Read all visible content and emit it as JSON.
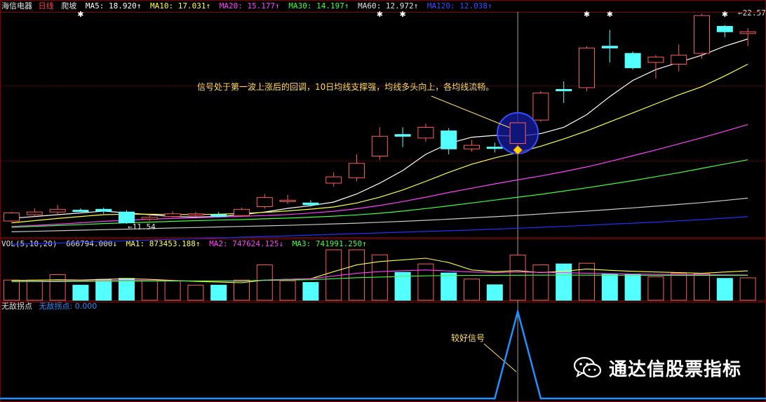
{
  "header_main": {
    "stock_name": "海信电器",
    "period": "日线",
    "indicator": "爬坡",
    "ma5": "MA5: 18.920↑",
    "ma10": "MA10: 17.031↑",
    "ma20": "MA20: 15.177↑",
    "ma30": "MA30: 14.197↑",
    "ma60": "MA60: 12.972↑",
    "ma120": "MA120: 12.038↑"
  },
  "header_vol": {
    "label": "VOL(5,10,20)",
    "vol": "666794.000↓",
    "ma1": "MA1: 873453.188↑",
    "ma2": "MA2: 747624.125↓",
    "ma3": "MA3: 741991.250↑"
  },
  "header_sig": {
    "label": "无敌拐点",
    "value": "无敌拐点: 0.000"
  },
  "annotations": {
    "main_note": "信号处于第一波上涨后的回调，10日均线支撑强，均线多头向上，各均线流畅。",
    "signal_note": "较好信号",
    "high_label": "22.57",
    "low_label": "11.54"
  },
  "watermark": {
    "text": "通达信股票指标",
    "icon": "wechat-icon"
  },
  "colors": {
    "up": "#ff5a5a",
    "down": "#54ffff",
    "grid": "#800000",
    "ma5": "#ffffff",
    "ma10": "#ffff40",
    "ma20": "#ff40ff",
    "ma30": "#40ff40",
    "ma60": "#c8c8c8",
    "ma120": "#2030ff",
    "signal": "#1e90ff"
  },
  "chart_data": {
    "type": "candlestick",
    "price_range": [
      11.0,
      23.3
    ],
    "candles": [
      {
        "o": 11.7,
        "c": 12.15,
        "h": 12.2,
        "l": 11.65
      },
      {
        "o": 12.05,
        "c": 12.2,
        "h": 12.4,
        "l": 11.95
      },
      {
        "o": 12.2,
        "c": 12.35,
        "h": 12.6,
        "l": 12.05
      },
      {
        "o": 12.3,
        "c": 12.25,
        "h": 12.4,
        "l": 12.2
      },
      {
        "o": 12.35,
        "c": 12.25,
        "h": 12.45,
        "l": 12.1
      },
      {
        "o": 12.2,
        "c": 11.6,
        "h": 12.3,
        "l": 11.54
      },
      {
        "o": 11.8,
        "c": 11.9,
        "h": 12.1,
        "l": 11.7
      },
      {
        "o": 11.95,
        "c": 12.1,
        "h": 12.25,
        "l": 11.9
      },
      {
        "o": 12.05,
        "c": 12.1,
        "h": 12.2,
        "l": 11.95
      },
      {
        "o": 12.05,
        "c": 11.95,
        "h": 12.2,
        "l": 11.9
      },
      {
        "o": 12.0,
        "c": 12.35,
        "h": 12.45,
        "l": 11.95
      },
      {
        "o": 12.5,
        "c": 13.0,
        "h": 13.2,
        "l": 12.4
      },
      {
        "o": 12.85,
        "c": 12.85,
        "h": 13.15,
        "l": 12.65
      },
      {
        "o": 12.7,
        "c": 12.6,
        "h": 12.85,
        "l": 12.5
      },
      {
        "o": 13.8,
        "c": 14.15,
        "h": 14.4,
        "l": 13.6
      },
      {
        "o": 14.1,
        "c": 14.9,
        "h": 15.4,
        "l": 13.9
      },
      {
        "o": 15.3,
        "c": 16.4,
        "h": 16.9,
        "l": 15.1
      },
      {
        "o": 16.5,
        "c": 16.4,
        "h": 16.9,
        "l": 15.8
      },
      {
        "o": 16.3,
        "c": 16.9,
        "h": 17.1,
        "l": 16.1
      },
      {
        "o": 16.7,
        "c": 15.7,
        "h": 16.85,
        "l": 15.4
      },
      {
        "o": 15.7,
        "c": 15.9,
        "h": 16.2,
        "l": 15.55
      },
      {
        "o": 15.8,
        "c": 15.75,
        "h": 16.05,
        "l": 15.5
      },
      {
        "o": 16.0,
        "c": 17.15,
        "h": 17.2,
        "l": 15.95
      },
      {
        "o": 17.3,
        "c": 18.8,
        "h": 18.9,
        "l": 17.2
      },
      {
        "o": 19.0,
        "c": 18.95,
        "h": 19.45,
        "l": 18.25
      },
      {
        "o": 19.1,
        "c": 21.3,
        "h": 21.4,
        "l": 18.9
      },
      {
        "o": 21.4,
        "c": 21.3,
        "h": 22.3,
        "l": 20.5
      },
      {
        "o": 21.0,
        "c": 20.2,
        "h": 21.1,
        "l": 20.1
      },
      {
        "o": 20.5,
        "c": 20.8,
        "h": 20.9,
        "l": 19.6
      },
      {
        "o": 20.4,
        "c": 20.9,
        "h": 21.5,
        "l": 20.0
      },
      {
        "o": 21.0,
        "c": 23.1,
        "h": 23.2,
        "l": 20.7
      },
      {
        "o": 22.5,
        "c": 22.2,
        "h": 22.57,
        "l": 21.9
      },
      {
        "o": 22.1,
        "c": 22.2,
        "h": 22.4,
        "l": 21.4
      }
    ],
    "ma_lines": [
      {
        "name": "MA5",
        "values": [
          11.85,
          11.95,
          12.05,
          12.15,
          12.25,
          12.15,
          12.05,
          11.95,
          11.92,
          11.95,
          12.05,
          12.2,
          12.4,
          12.55,
          12.75,
          13.2,
          13.8,
          14.5,
          15.4,
          16.0,
          16.35,
          16.45,
          16.4,
          16.55,
          16.9,
          17.6,
          18.6,
          19.5,
          20.1,
          20.5,
          20.9,
          21.4,
          21.8
        ]
      },
      {
        "name": "MA10",
        "values": [
          11.6,
          11.72,
          11.84,
          11.95,
          12.05,
          12.08,
          12.08,
          12.06,
          12.06,
          12.08,
          12.12,
          12.18,
          12.26,
          12.36,
          12.48,
          12.7,
          13.02,
          13.42,
          13.9,
          14.4,
          14.85,
          15.2,
          15.5,
          15.85,
          16.25,
          16.7,
          17.2,
          17.7,
          18.2,
          18.7,
          19.15,
          19.75,
          20.4
        ]
      },
      {
        "name": "MA20",
        "values": [
          11.4,
          11.45,
          11.52,
          11.6,
          11.68,
          11.74,
          11.8,
          11.84,
          11.88,
          11.92,
          11.96,
          12.0,
          12.06,
          12.14,
          12.24,
          12.38,
          12.56,
          12.78,
          13.02,
          13.28,
          13.52,
          13.76,
          13.98,
          14.2,
          14.44,
          14.7,
          15.0,
          15.32,
          15.64,
          15.98,
          16.32,
          16.68,
          17.05
        ]
      },
      {
        "name": "MA30",
        "values": [
          11.35,
          11.4,
          11.45,
          11.5,
          11.56,
          11.6,
          11.64,
          11.68,
          11.72,
          11.75,
          11.78,
          11.82,
          11.86,
          11.91,
          11.97,
          12.04,
          12.13,
          12.25,
          12.39,
          12.54,
          12.7,
          12.86,
          13.02,
          13.18,
          13.36,
          13.54,
          13.74,
          13.94,
          14.16,
          14.38,
          14.62,
          14.86,
          15.1
        ]
      },
      {
        "name": "MA60",
        "values": [
          11.1,
          11.13,
          11.16,
          11.19,
          11.22,
          11.25,
          11.28,
          11.31,
          11.34,
          11.37,
          11.4,
          11.43,
          11.46,
          11.5,
          11.54,
          11.58,
          11.63,
          11.68,
          11.74,
          11.8,
          11.87,
          11.94,
          12.01,
          12.09,
          12.17,
          12.25,
          12.34,
          12.43,
          12.52,
          12.62,
          12.72,
          12.84,
          12.97
        ]
      },
      {
        "name": "MA120",
        "values": [
          10.4,
          10.44,
          10.48,
          10.52,
          10.56,
          10.6,
          10.64,
          10.68,
          10.72,
          10.76,
          10.8,
          10.84,
          10.88,
          10.92,
          10.96,
          11.0,
          11.04,
          11.08,
          11.12,
          11.16,
          11.2,
          11.25,
          11.3,
          11.35,
          11.4,
          11.46,
          11.52,
          11.58,
          11.64,
          11.71,
          11.78,
          11.86,
          11.94
        ]
      }
    ],
    "volume": {
      "range": [
        0,
        1500000
      ],
      "values": [
        600000,
        600000,
        760000,
        450000,
        620000,
        650000,
        580000,
        570000,
        450000,
        450000,
        600000,
        1050000,
        580000,
        530000,
        2250000,
        1650000,
        1350000,
        830000,
        1080000,
        810000,
        630000,
        460000,
        1340000,
        1050000,
        1080000,
        1100000,
        770000,
        780000,
        700000,
        800000,
        790000,
        650000,
        666794
      ],
      "ma_lines": [
        {
          "name": "MA1",
          "values": [
            590000,
            595000,
            610000,
            600000,
            620000,
            640000,
            620000,
            590000,
            560000,
            540000,
            520000,
            600000,
            620000,
            640000,
            850000,
            1050000,
            1150000,
            1200000,
            1250000,
            1120000,
            900000,
            850000,
            880000,
            820000,
            860000,
            930000,
            890000,
            860000,
            840000,
            820000,
            800000,
            840000,
            873453
          ]
        },
        {
          "name": "MA2",
          "values": [
            560000,
            565000,
            575000,
            580000,
            585000,
            590000,
            585000,
            580000,
            575000,
            570000,
            565000,
            600000,
            620000,
            640000,
            720000,
            800000,
            850000,
            880000,
            900000,
            870000,
            840000,
            820000,
            840000,
            830000,
            820000,
            800000,
            790000,
            780000,
            770000,
            765000,
            760000,
            755000,
            747624
          ]
        },
        {
          "name": "MA3",
          "values": [
            550000,
            552000,
            555000,
            558000,
            562000,
            566000,
            570000,
            572000,
            574000,
            576000,
            578000,
            590000,
            600000,
            610000,
            640000,
            670000,
            690000,
            710000,
            725000,
            735000,
            740000,
            742000,
            744000,
            746000,
            748000,
            746000,
            744000,
            743000,
            742000,
            742000,
            741500,
            741800,
            741991
          ]
        }
      ]
    },
    "signal": {
      "range": [
        0,
        1
      ],
      "values": [
        0,
        0,
        0,
        0,
        0,
        0,
        0,
        0,
        0,
        0,
        0,
        0,
        0,
        0,
        0,
        0,
        0,
        0,
        0,
        0,
        0,
        0,
        1,
        0,
        0,
        0,
        0,
        0,
        0,
        0,
        0,
        0,
        0
      ]
    },
    "markers": {
      "signal_day_index": 22,
      "high_index": 31,
      "low_index": 5
    }
  }
}
